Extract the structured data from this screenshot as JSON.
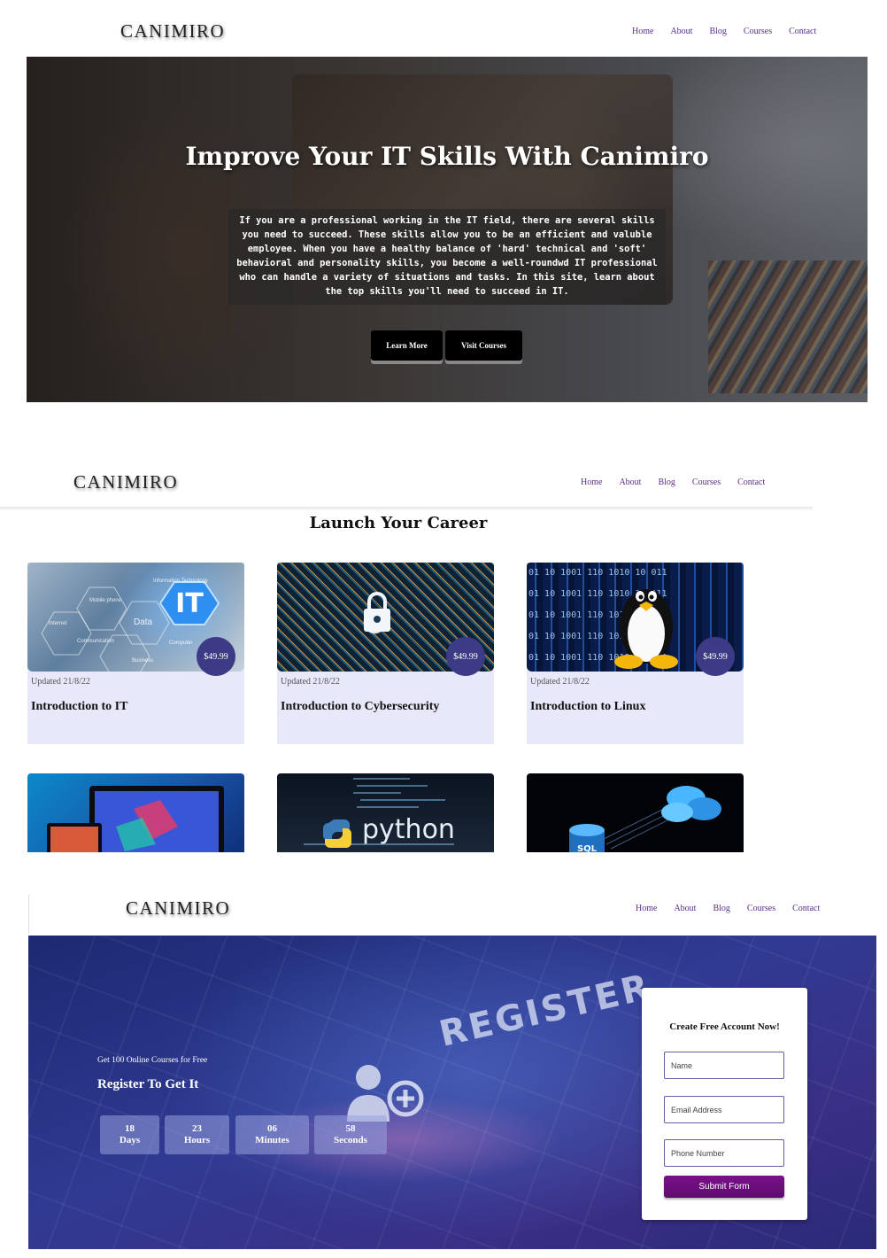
{
  "brand": "CANIMIRO",
  "nav_items": [
    "Home",
    "About",
    "Blog",
    "Courses",
    "Contact"
  ],
  "hero": {
    "title": "Improve Your IT Skills With Canimiro",
    "description": "If you are a professional working in the IT field, there are several skills you need to succeed. These skills allow you to be an efficient and valuble employee. When you have a healthy balance of 'hard' technical and 'soft' behavioral and personality skills, you become a well-roundwd IT professional who can handle a variety of situations and tasks. In this site, learn about the top skills you'll need to succeed in IT.",
    "buttons": [
      "Learn More",
      "Visit Courses"
    ]
  },
  "courses": {
    "heading": "Launch Your Career",
    "cards": [
      {
        "title": "Introduction to IT",
        "price": "$49.99",
        "updated": "Updated 21/8/22",
        "image_label": "IT",
        "image_words": [
          "Information Technology",
          "Mobile phone",
          "Data",
          "Internet",
          "Computer",
          "Communication",
          "Business"
        ]
      },
      {
        "title": "Introduction to Cybersecurity",
        "price": "$49.99",
        "updated": "Updated 21/8/22"
      },
      {
        "title": "Introduction to Linux",
        "price": "$49.99",
        "updated": "Updated 21/8/22",
        "binary_text": "01 10 1001 110 1010 10 011"
      }
    ],
    "partial_cards": [
      {
        "image_text": ""
      },
      {
        "image_text": "python"
      },
      {
        "image_text": "SQL"
      }
    ]
  },
  "register": {
    "image_text": "REGISTER",
    "subtitle": "Get 100 Online Courses for Free",
    "heading": "Register To Get It",
    "countdown": [
      {
        "value": "18",
        "unit": "Days"
      },
      {
        "value": "23",
        "unit": "Hours"
      },
      {
        "value": "06",
        "unit": "Minutes"
      },
      {
        "value": "58",
        "unit": "Seconds"
      }
    ],
    "form": {
      "title": "Create Free Account Now!",
      "name_placeholder": "Name",
      "email_placeholder": "Email Address",
      "phone_placeholder": "Phone Number",
      "submit": "Submit Form"
    }
  },
  "colors": {
    "nav_link": "#5a2d8c",
    "card_bg": "#e8e8fb",
    "price_badge": "#3e3b86",
    "submit": "#6e0f7e"
  }
}
